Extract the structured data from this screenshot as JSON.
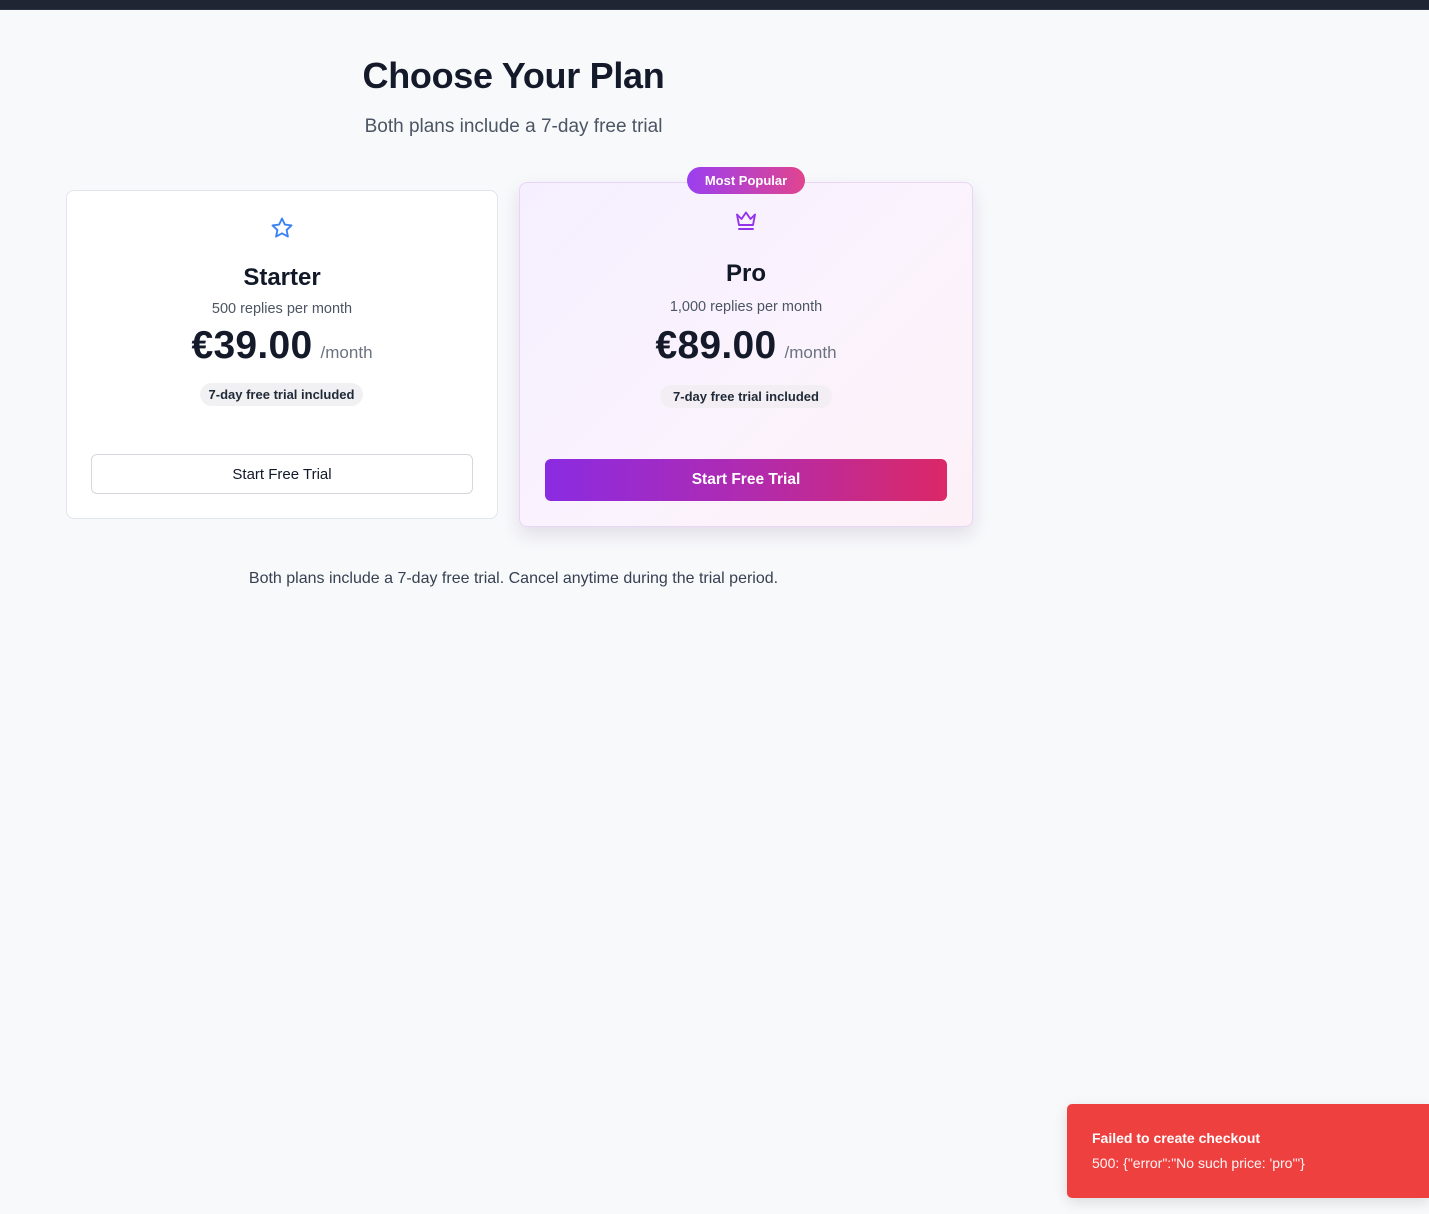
{
  "header": {
    "title": "Choose Your Plan",
    "subtitle": "Both plans include a 7-day free trial"
  },
  "plans": [
    {
      "icon": "star-icon",
      "name": "Starter",
      "replies": "500 replies per month",
      "price": "€39.00",
      "period": "/month",
      "trial_badge": "7-day free trial included",
      "cta": "Start Free Trial",
      "accent_color": "#3b82f6"
    },
    {
      "icon": "crown-icon",
      "badge": "Most Popular",
      "name": "Pro",
      "replies": "1,000 replies per month",
      "price": "€89.00",
      "period": "/month",
      "trial_badge": "7-day free trial included",
      "cta": "Start Free Trial",
      "accent_color": "#9333ea"
    }
  ],
  "footer_note": "Both plans include a 7-day free trial. Cancel anytime during the trial period.",
  "toast": {
    "title": "Failed to create checkout",
    "message": "500: {\"error\":\"No such price: 'pro'\"}",
    "color": "#ef4040"
  }
}
